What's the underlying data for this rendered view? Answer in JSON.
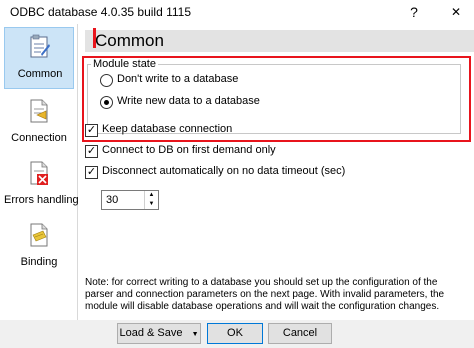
{
  "window": {
    "title": "ODBC database 4.0.35 build 1115",
    "help": "?",
    "close": "✕"
  },
  "sidebar": {
    "items": [
      {
        "label": "Common",
        "icon": "common-settings-icon"
      },
      {
        "label": "Connection",
        "icon": "connection-icon"
      },
      {
        "label": "Errors handling",
        "icon": "errors-handling-icon"
      },
      {
        "label": "Binding",
        "icon": "binding-icon"
      }
    ]
  },
  "main": {
    "heading": "Common",
    "module_state": {
      "legend": "Module state",
      "options": [
        {
          "label": "Don't write to a database",
          "selected": false
        },
        {
          "label": "Write new data to a database",
          "selected": true
        }
      ]
    },
    "checkboxes": [
      {
        "label": "Keep database connection",
        "checked": true
      },
      {
        "label": "Connect to DB on first demand only",
        "checked": true
      },
      {
        "label": "Disconnect automatically on no data timeout (sec)",
        "checked": true
      }
    ],
    "timeout_value": "30",
    "note": "Note: for correct writing to a database you should set up the configuration of the parser and connection parameters on the next page. With invalid parameters, the module will disable database operations and will wait the configuration changes."
  },
  "buttons": {
    "load_save": "Load & Save",
    "ok": "OK",
    "cancel": "Cancel"
  },
  "colors": {
    "highlight": "#e8141c",
    "selected_bg": "#cce4f7"
  }
}
